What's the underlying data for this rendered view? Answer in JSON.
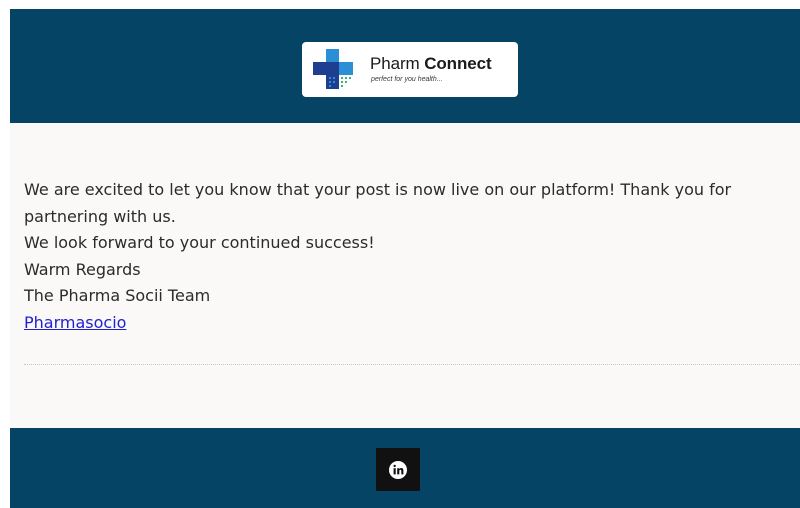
{
  "header": {
    "logo": {
      "brand_first": "Pharm",
      "brand_second": "Connect",
      "tagline": "perfect for you health...",
      "colors": {
        "cross_dark": "#1e3f8f",
        "cross_light": "#2a8fd6",
        "accent_green": "#39b37a"
      }
    },
    "background": "#054465"
  },
  "message": {
    "line1": "We are excited to let you know that your post is now live on our platform! Thank you for partnering with us.",
    "line2": "We look forward to your continued success!",
    "line3": "Warm Regards",
    "line4": "The Pharma Socii Team",
    "link_label": "Pharmasocio"
  },
  "footer": {
    "social_icon": "linkedin-icon",
    "background": "#054465"
  }
}
